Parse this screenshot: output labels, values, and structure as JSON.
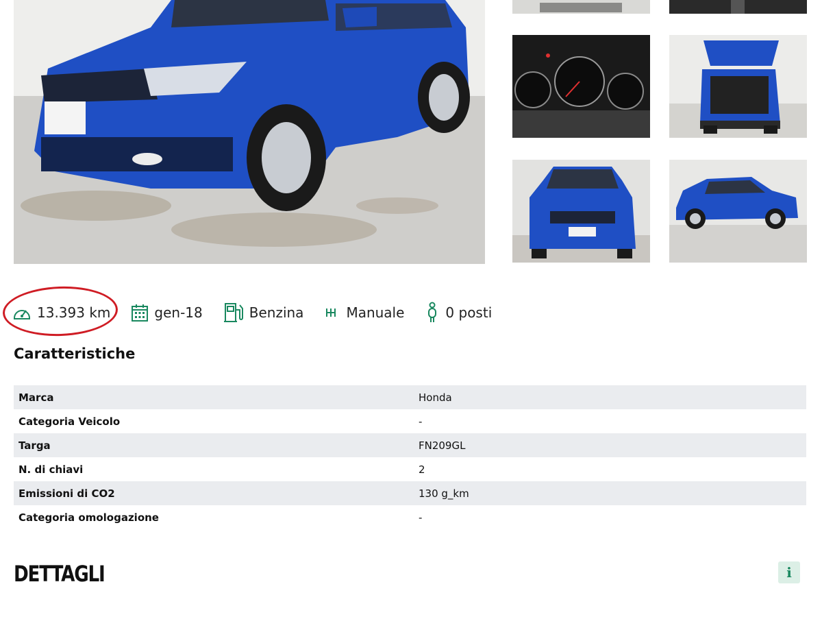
{
  "specs": {
    "mileage": "13.393 km",
    "registration_date": "gen-18",
    "fuel": "Benzina",
    "transmission": "Manuale",
    "seats": "0 posti"
  },
  "characteristics": {
    "title": "Caratteristiche",
    "rows": [
      {
        "label": "Marca",
        "value": "Honda"
      },
      {
        "label": "Categoria Veicolo",
        "value": "-"
      },
      {
        "label": "Targa",
        "value": "FN209GL"
      },
      {
        "label": "N. di chiavi",
        "value": "2"
      },
      {
        "label": "Emissioni di CO2",
        "value": "130 g_km"
      },
      {
        "label": "Categoria omologazione",
        "value": "-"
      }
    ]
  },
  "details": {
    "title": "DETTAGLI",
    "info_icon_text": "i"
  },
  "colors": {
    "accent_green": "#19885f",
    "highlight_red": "#cf1c24",
    "car_blue": "#1f4fc4",
    "table_stripe": "#eaecef"
  },
  "icons": {
    "mileage": "speedometer-icon",
    "registration": "calendar-icon",
    "fuel": "fuel-pump-icon",
    "transmission": "gearbox-icon",
    "seats": "person-icon",
    "info": "info-icon"
  }
}
